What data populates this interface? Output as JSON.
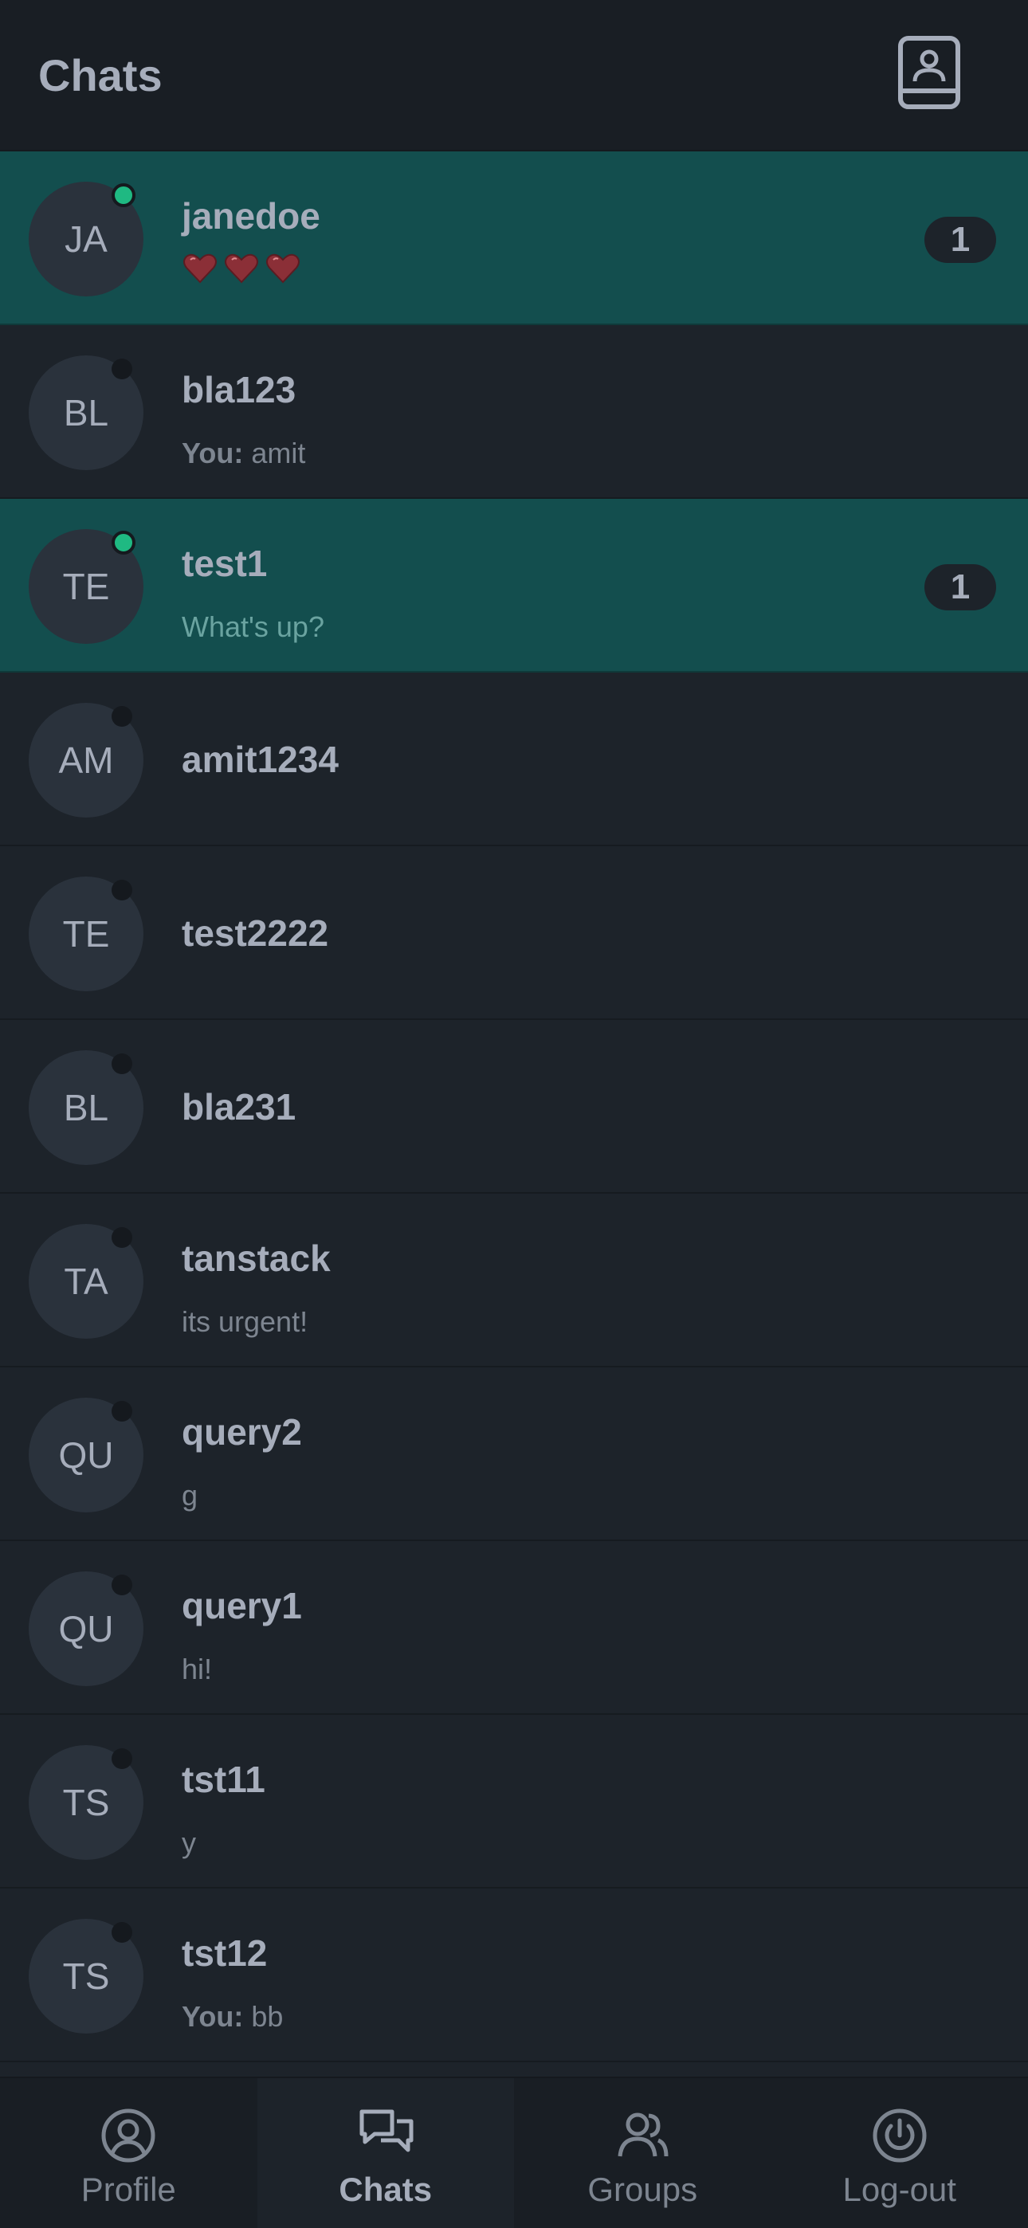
{
  "header": {
    "title": "Chats"
  },
  "chats": [
    {
      "initials": "JA",
      "name": "janedoe",
      "preview": "",
      "you_prefix": "",
      "badge": "1",
      "online": true,
      "unread": true,
      "hearts": true
    },
    {
      "initials": "BL",
      "name": "bla123",
      "preview": "amit",
      "you_prefix": "You:",
      "badge": "",
      "online": false,
      "unread": false
    },
    {
      "initials": "TE",
      "name": "test1",
      "preview": "What's up?",
      "you_prefix": "",
      "badge": "1",
      "online": true,
      "unread": true
    },
    {
      "initials": "AM",
      "name": "amit1234",
      "preview": "",
      "you_prefix": "",
      "badge": "",
      "online": false,
      "unread": false
    },
    {
      "initials": "TE",
      "name": "test2222",
      "preview": "",
      "you_prefix": "",
      "badge": "",
      "online": false,
      "unread": false
    },
    {
      "initials": "BL",
      "name": "bla231",
      "preview": "",
      "you_prefix": "",
      "badge": "",
      "online": false,
      "unread": false
    },
    {
      "initials": "TA",
      "name": "tanstack",
      "preview": "its urgent!",
      "you_prefix": "",
      "badge": "",
      "online": false,
      "unread": false
    },
    {
      "initials": "QU",
      "name": "query2",
      "preview": "g",
      "you_prefix": "",
      "badge": "",
      "online": false,
      "unread": false
    },
    {
      "initials": "QU",
      "name": "query1",
      "preview": "hi!",
      "you_prefix": "",
      "badge": "",
      "online": false,
      "unread": false
    },
    {
      "initials": "TS",
      "name": "tst11",
      "preview": "y",
      "you_prefix": "",
      "badge": "",
      "online": false,
      "unread": false
    },
    {
      "initials": "TS",
      "name": "tst12",
      "preview": "bb",
      "you_prefix": "You:",
      "badge": "",
      "online": false,
      "unread": false
    }
  ],
  "nav": {
    "profile": "Profile",
    "chats": "Chats",
    "groups": "Groups",
    "logout": "Log-out"
  },
  "icons": {
    "contacts": "contacts-book-icon",
    "heart": "heart-icon",
    "profile": "user-circle-icon",
    "chats": "chat-bubbles-icon",
    "groups": "users-icon",
    "logout": "power-icon"
  },
  "colors": {
    "unread_row": "#134e4e",
    "online": "#1fb982",
    "background": "#1d232a",
    "heart": "#8b2f37"
  }
}
